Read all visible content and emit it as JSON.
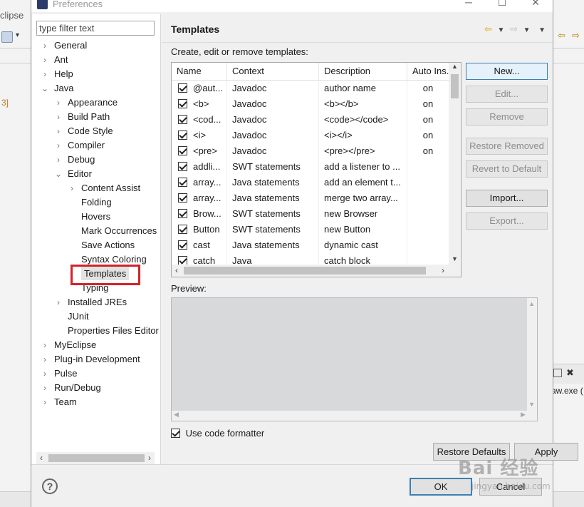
{
  "background": {
    "left_title": "clipse",
    "left_number": "3]",
    "right_console_text": "aw.exe ("
  },
  "window": {
    "title": "Preferences",
    "minimize": "─",
    "maximize": "☐",
    "close": "✕"
  },
  "sidebar": {
    "filter_placeholder": "type filter text",
    "items": [
      {
        "label": "General",
        "depth": 0,
        "expander": "collapsed"
      },
      {
        "label": "Ant",
        "depth": 0,
        "expander": "collapsed"
      },
      {
        "label": "Help",
        "depth": 0,
        "expander": "collapsed"
      },
      {
        "label": "Java",
        "depth": 0,
        "expander": "expanded"
      },
      {
        "label": "Appearance",
        "depth": 1,
        "expander": "collapsed"
      },
      {
        "label": "Build Path",
        "depth": 1,
        "expander": "collapsed"
      },
      {
        "label": "Code Style",
        "depth": 1,
        "expander": "collapsed"
      },
      {
        "label": "Compiler",
        "depth": 1,
        "expander": "collapsed"
      },
      {
        "label": "Debug",
        "depth": 1,
        "expander": "collapsed"
      },
      {
        "label": "Editor",
        "depth": 1,
        "expander": "expanded"
      },
      {
        "label": "Content Assist",
        "depth": 2,
        "expander": "collapsed"
      },
      {
        "label": "Folding",
        "depth": 2,
        "expander": "none"
      },
      {
        "label": "Hovers",
        "depth": 2,
        "expander": "none"
      },
      {
        "label": "Mark Occurrences",
        "depth": 2,
        "expander": "none"
      },
      {
        "label": "Save Actions",
        "depth": 2,
        "expander": "none"
      },
      {
        "label": "Syntax Coloring",
        "depth": 2,
        "expander": "none"
      },
      {
        "label": "Templates",
        "depth": 2,
        "expander": "none",
        "selected": true
      },
      {
        "label": "Typing",
        "depth": 2,
        "expander": "none"
      },
      {
        "label": "Installed JREs",
        "depth": 1,
        "expander": "collapsed"
      },
      {
        "label": "JUnit",
        "depth": 1,
        "expander": "none"
      },
      {
        "label": "Properties Files Editor",
        "depth": 1,
        "expander": "none"
      },
      {
        "label": "MyEclipse",
        "depth": 0,
        "expander": "collapsed"
      },
      {
        "label": "Plug-in Development",
        "depth": 0,
        "expander": "collapsed"
      },
      {
        "label": "Pulse",
        "depth": 0,
        "expander": "collapsed"
      },
      {
        "label": "Run/Debug",
        "depth": 0,
        "expander": "collapsed"
      },
      {
        "label": "Team",
        "depth": 0,
        "expander": "collapsed"
      }
    ]
  },
  "page": {
    "title": "Templates",
    "description": "Create, edit or remove templates:",
    "columns": [
      "Name",
      "Context",
      "Description",
      "Auto Ins."
    ],
    "rows": [
      {
        "checked": true,
        "name": "@aut...",
        "context": "Javadoc",
        "description": "author name",
        "auto": "on"
      },
      {
        "checked": true,
        "name": "<b>",
        "context": "Javadoc",
        "description": "<b></b>",
        "auto": "on"
      },
      {
        "checked": true,
        "name": "<cod...",
        "context": "Javadoc",
        "description": "<code></code>",
        "auto": "on"
      },
      {
        "checked": true,
        "name": "<i>",
        "context": "Javadoc",
        "description": "<i></i>",
        "auto": "on"
      },
      {
        "checked": true,
        "name": "<pre>",
        "context": "Javadoc",
        "description": "<pre></pre>",
        "auto": "on"
      },
      {
        "checked": true,
        "name": "addli...",
        "context": "SWT statements",
        "description": "add a listener to ...",
        "auto": ""
      },
      {
        "checked": true,
        "name": "array...",
        "context": "Java statements",
        "description": "add an element t...",
        "auto": ""
      },
      {
        "checked": true,
        "name": "array...",
        "context": "Java statements",
        "description": "merge two array...",
        "auto": ""
      },
      {
        "checked": true,
        "name": "Brow...",
        "context": "SWT statements",
        "description": "new Browser",
        "auto": ""
      },
      {
        "checked": true,
        "name": "Button",
        "context": "SWT statements",
        "description": "new Button",
        "auto": ""
      },
      {
        "checked": true,
        "name": "cast",
        "context": "Java statements",
        "description": "dynamic cast",
        "auto": ""
      },
      {
        "checked": true,
        "name": "catch",
        "context": "Java",
        "description": "catch block",
        "auto": ""
      }
    ],
    "buttons": {
      "new": "New...",
      "edit": "Edit...",
      "remove": "Remove",
      "restore_removed": "Restore Removed",
      "revert_to_default": "Revert to Default",
      "import": "Import...",
      "export": "Export..."
    },
    "preview_label": "Preview:",
    "use_code_formatter": "Use code formatter",
    "restore_defaults": "Restore Defaults",
    "apply": "Apply"
  },
  "footer": {
    "help": "?",
    "ok": "OK",
    "cancel": "Cancel"
  },
  "watermark": {
    "main": "Bai 经验",
    "sub": "jingyan.baidu.com"
  },
  "colors": {
    "highlight_box": "#d3222a",
    "selection": "#e2e2e2",
    "primary_border": "#3c7fb1"
  }
}
